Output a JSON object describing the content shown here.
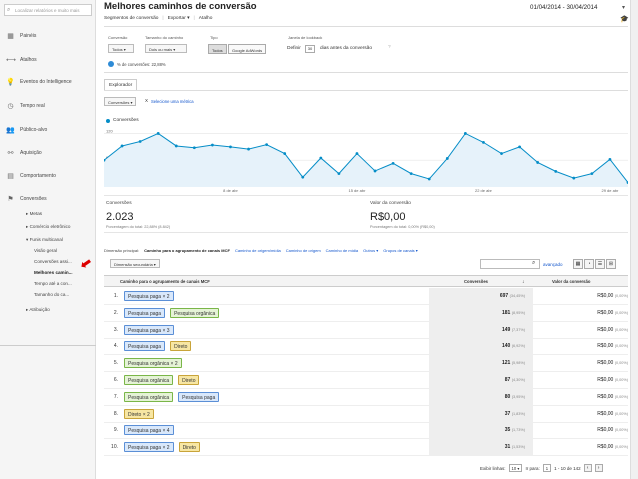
{
  "sidebar": {
    "search_placeholder": "Localizar relatórios e muito mais",
    "items": [
      {
        "label": "Painéis",
        "icon": "dashboard-icon",
        "glyph": "▦"
      },
      {
        "label": "Atalhos",
        "icon": "shortcut-icon",
        "glyph": "⟷"
      },
      {
        "label": "Eventos do Intelligence",
        "icon": "lightbulb-icon",
        "glyph": "💡"
      },
      {
        "label": "Tempo real",
        "icon": "clock-icon",
        "glyph": "◷"
      },
      {
        "label": "Público-alvo",
        "icon": "audience-icon",
        "glyph": "👥"
      },
      {
        "label": "Aquisição",
        "icon": "acquisition-icon",
        "glyph": "⚯"
      },
      {
        "label": "Comportamento",
        "icon": "behavior-icon",
        "glyph": "▤"
      },
      {
        "label": "Conversões",
        "icon": "flag-icon",
        "glyph": "⚑"
      }
    ],
    "sub_items": [
      "▸ Metas",
      "▸ Comércio eletrônico",
      "▾ Funis multicanal",
      "Visão geral",
      "Conversões assi...",
      "Melhores camin...",
      "Tempo até a con...",
      "Tamanho do ca...",
      "▸ Atribuição"
    ]
  },
  "header": {
    "title": "Melhores caminhos de conversão",
    "date_range": "01/04/2014 - 30/04/2014",
    "toolbar": [
      "Segmentos de conversão",
      "Exportar ▾",
      "Atalho"
    ]
  },
  "filters": {
    "conversion_label": "Conversão",
    "conversion_value": "Todos ▾",
    "path_length_label": "Tamanho do caminho",
    "path_length_value": "Dois ou mais ▾",
    "type_label": "Tipo",
    "type_all": "Todos",
    "type_adwords": "Google AdWords",
    "lookback_label": "Janela de lookback",
    "define_prefix": "Definir",
    "lookback_value": "30",
    "define_suffix": "dias antes da conversão",
    "segment_note": "% de conversões: 22,88%"
  },
  "explorer": {
    "tab": "Explorador",
    "metric": "Conversões ▾",
    "vs": "X",
    "select_metric": "Selecione uma métrica",
    "legend": "Conversões"
  },
  "chart_data": {
    "type": "line",
    "x": [
      "1 de abr",
      "2 de abr",
      "3 de abr",
      "4 de abr",
      "5 de abr",
      "6 de abr",
      "7 de abr",
      "8 de abr",
      "9 de abr",
      "10 de abr",
      "11 de abr",
      "12 de abr",
      "13 de abr",
      "14 de abr",
      "15 de abr",
      "16 de abr",
      "17 de abr",
      "18 de abr",
      "19 de abr",
      "20 de abr",
      "21 de abr",
      "22 de abr",
      "23 de abr",
      "24 de abr",
      "25 de abr",
      "26 de abr",
      "27 de abr",
      "28 de abr",
      "29 de abr",
      "30 de abr"
    ],
    "series": [
      {
        "name": "Conversões",
        "values": [
          60,
          92,
          102,
          120,
          92,
          88,
          94,
          90,
          85,
          95,
          75,
          22,
          65,
          30,
          75,
          36,
          53,
          30,
          18,
          64,
          120,
          100,
          75,
          90,
          55,
          35,
          20,
          30,
          62,
          10
        ]
      }
    ],
    "ylim": [
      0,
      130
    ],
    "y_ticks": [
      "120",
      "60"
    ],
    "x_tick_labels": [
      "8 de abr",
      "15 de abr",
      "22 de abr",
      "29 de abr"
    ],
    "x_tick_index": [
      7,
      14,
      21,
      28
    ],
    "grid": true,
    "color": "#058dc7"
  },
  "summary": {
    "conv_label": "Conversões",
    "conv_value": "2.023",
    "conv_sub": "Porcentagem do total: 22,88% (8.842)",
    "val_label": "Valor da conversão",
    "val_value": "R$0,00",
    "val_sub": "Porcentagem do total: 0,00% (R$0,00)"
  },
  "dimensions": {
    "label": "Dimensão principal:",
    "selected": "Caminho para o agrupamento de canais MCF",
    "links": [
      "Caminho de origem/mídia",
      "Caminho de origem",
      "Caminho de mídia",
      "Outros ▾",
      "Grupos de canais ▾"
    ],
    "secondary": "Dimensão secundária ▾",
    "search_icon": "search-icon",
    "advanced": "avançado"
  },
  "table": {
    "columns": [
      "Caminho para o agrupamento de canais MCF",
      "Conversões",
      "Valor da conversão"
    ],
    "rows": [
      {
        "n": "1.",
        "path": [
          {
            "t": "Pesquisa paga × 2",
            "c": "blue"
          }
        ],
        "conv": "697",
        "conv_pct": "(34,45%)",
        "val": "R$0,00",
        "val_pct": "(0,00%)"
      },
      {
        "n": "2.",
        "path": [
          {
            "t": "Pesquisa paga",
            "c": "blue"
          },
          {
            "t": "Pesquisa orgânica",
            "c": "green"
          }
        ],
        "conv": "181",
        "conv_pct": "(8,95%)",
        "val": "R$0,00",
        "val_pct": "(0,00%)"
      },
      {
        "n": "3.",
        "path": [
          {
            "t": "Pesquisa paga × 3",
            "c": "blue"
          }
        ],
        "conv": "149",
        "conv_pct": "(7,37%)",
        "val": "R$0,00",
        "val_pct": "(0,00%)"
      },
      {
        "n": "4.",
        "path": [
          {
            "t": "Pesquisa paga",
            "c": "blue"
          },
          {
            "t": "Direto",
            "c": "yellow"
          }
        ],
        "conv": "140",
        "conv_pct": "(6,92%)",
        "val": "R$0,00",
        "val_pct": "(0,00%)"
      },
      {
        "n": "5.",
        "path": [
          {
            "t": "Pesquisa orgânica × 2",
            "c": "green"
          }
        ],
        "conv": "121",
        "conv_pct": "(5,98%)",
        "val": "R$0,00",
        "val_pct": "(0,00%)"
      },
      {
        "n": "6.",
        "path": [
          {
            "t": "Pesquisa orgânica",
            "c": "green"
          },
          {
            "t": "Direto",
            "c": "yellow"
          }
        ],
        "conv": "87",
        "conv_pct": "(4,30%)",
        "val": "R$0,00",
        "val_pct": "(0,00%)"
      },
      {
        "n": "7.",
        "path": [
          {
            "t": "Pesquisa orgânica",
            "c": "green"
          },
          {
            "t": "Pesquisa paga",
            "c": "blue"
          }
        ],
        "conv": "80",
        "conv_pct": "(3,95%)",
        "val": "R$0,00",
        "val_pct": "(0,00%)"
      },
      {
        "n": "8.",
        "path": [
          {
            "t": "Direto × 2",
            "c": "yellow"
          }
        ],
        "conv": "37",
        "conv_pct": "(1,83%)",
        "val": "R$0,00",
        "val_pct": "(0,00%)"
      },
      {
        "n": "9.",
        "path": [
          {
            "t": "Pesquisa paga × 4",
            "c": "blue"
          }
        ],
        "conv": "35",
        "conv_pct": "(1,73%)",
        "val": "R$0,00",
        "val_pct": "(0,00%)"
      },
      {
        "n": "10.",
        "path": [
          {
            "t": "Pesquisa paga × 2",
            "c": "blue"
          },
          {
            "t": "Direto",
            "c": "yellow"
          }
        ],
        "conv": "31",
        "conv_pct": "(1,53%)",
        "val": "R$0,00",
        "val_pct": "(0,00%)"
      }
    ]
  },
  "pager": {
    "show_rows": "Exibir linhas:",
    "rows_value": "10 ▾",
    "goto": "Ir para:",
    "goto_value": "1",
    "range": "1 - 10 de 142",
    "prev": "‹",
    "next": "›"
  },
  "colors": {
    "chip_blue_bg": "#d9e8fb",
    "chip_blue_border": "#5b8fd6",
    "chip_green_bg": "#e5f3d6",
    "chip_green_border": "#7ab648",
    "chip_yellow_bg": "#f7e6a3",
    "chip_yellow_border": "#c8a43a"
  }
}
